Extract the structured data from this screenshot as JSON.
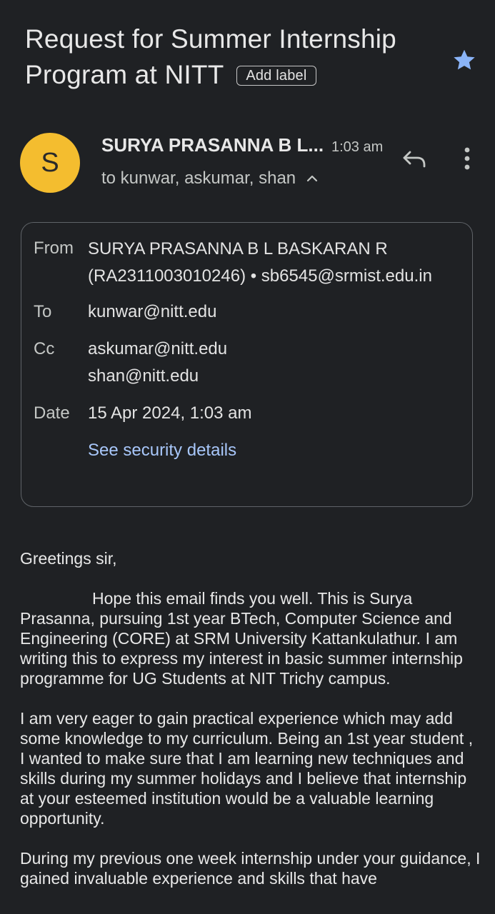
{
  "subject": {
    "title": "Request for Summer Internship Program at NITT",
    "add_label": "Add label"
  },
  "header": {
    "avatar_letter": "S",
    "avatar_color": "#f4bd2f",
    "sender_name": "SURYA PRASANNA B L...",
    "time": "1:03 am",
    "recipients_summary": "to kunwar, askumar, shan"
  },
  "details": {
    "from_label": "From",
    "from_line1": "SURYA PRASANNA B L BASKARAN R",
    "from_line2": "(RA2311003010246) • sb6545@srmist.edu.in",
    "to_label": "To",
    "to_value": "kunwar@nitt.edu",
    "cc_label": "Cc",
    "cc_value1": "askumar@nitt.edu",
    "cc_value2": "shan@nitt.edu",
    "date_label": "Date",
    "date_value": "15 Apr 2024, 1:03 am",
    "security_link": "See security details"
  },
  "body": {
    "greeting": "Greetings sir,",
    "para1": "Hope this email finds you well. This is Surya Prasanna, pursuing 1st year BTech, Computer Science and Engineering (CORE) at SRM University Kattankulathur. I am writing this to express my interest in basic summer internship programme for UG Students at NIT Trichy campus.",
    "para2": "I am very eager to gain practical experience which may add some knowledge  to my curriculum. Being an 1st year student , I wanted to make sure that I am  learning new techniques and skills   during my summer holidays and I believe that internship at your esteemed institution would be a valuable learning opportunity.",
    "para3": "During my previous one week internship under your guidance, I gained invaluable experience and skills that have"
  },
  "colors": {
    "background": "#1f2124",
    "star": "#8ab4f8",
    "link": "#a8c7fa"
  },
  "icons": {
    "star": "star-icon",
    "reply": "reply-icon",
    "more": "more-vert-icon",
    "chevron": "chevron-up-icon"
  }
}
